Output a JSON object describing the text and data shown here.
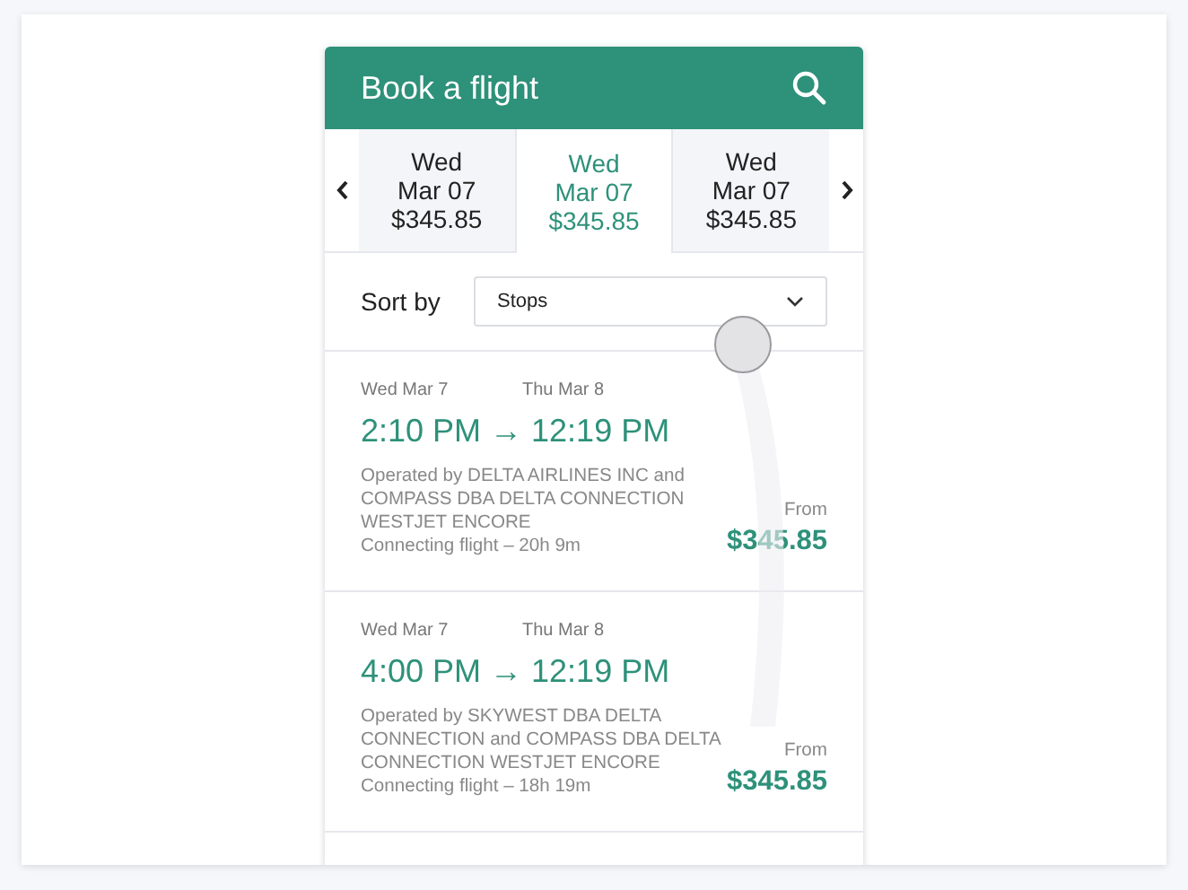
{
  "header": {
    "title": "Book a flight"
  },
  "date_tabs": [
    {
      "day": "Wed",
      "date": "Mar 07",
      "price": "$345.85",
      "selected": false
    },
    {
      "day": "Wed",
      "date": "Mar 07",
      "price": "$345.85",
      "selected": true
    },
    {
      "day": "Wed",
      "date": "Mar 07",
      "price": "$345.85",
      "selected": false
    }
  ],
  "sort": {
    "label": "Sort by",
    "value": "Stops"
  },
  "flights": [
    {
      "depart_date": "Wed Mar 7",
      "arrive_date": "Thu Mar 8",
      "times": "2:10 PM → 12:19 PM",
      "operator": "Operated by DELTA AIRLINES INC and COMPASS DBA DELTA CONNECTION WESTJET ENCORE",
      "duration": "Connecting flight – 20h 9m",
      "price_label": "From",
      "price": "$345.85"
    },
    {
      "depart_date": "Wed Mar 7",
      "arrive_date": "Thu Mar 8",
      "times": "4:00 PM → 12:19 PM",
      "operator": "Operated by SKYWEST DBA DELTA CONNECTION and COMPASS DBA DELTA CONNECTION WESTJET ENCORE",
      "duration": "Connecting flight – 18h 19m",
      "price_label": "From",
      "price": "$345.85"
    }
  ]
}
